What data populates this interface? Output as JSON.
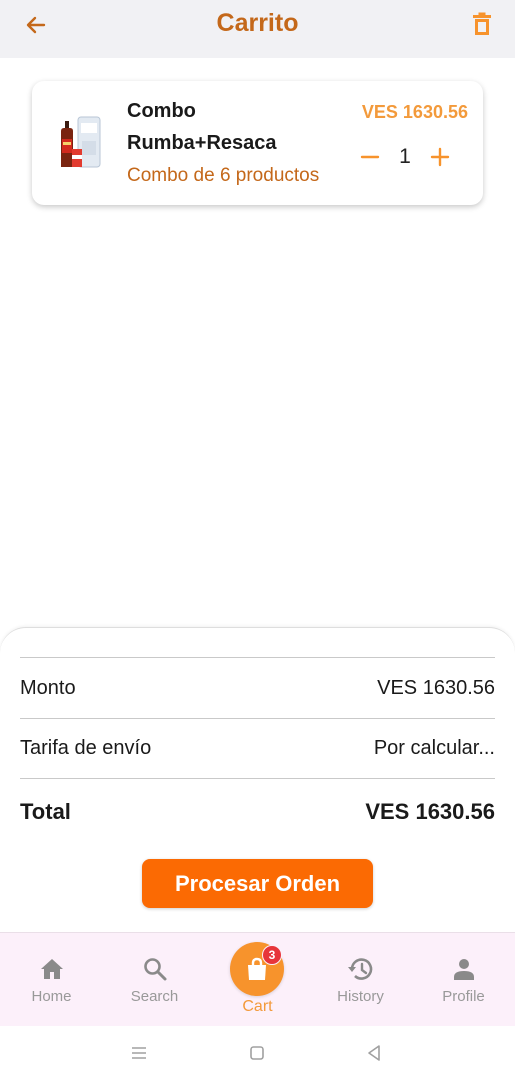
{
  "appbar": {
    "title": "Carrito",
    "back_icon": "arrow-left-icon",
    "delete_icon": "trash-icon"
  },
  "cart_item": {
    "name": "Combo Rumba+Resaca",
    "subtitle": "Combo de 6 productos",
    "price": "VES 1630.56",
    "quantity": "1",
    "decrement_icon": "minus-icon",
    "increment_icon": "plus-icon"
  },
  "summary": {
    "amount_label": "Monto",
    "amount_value": "VES 1630.56",
    "shipping_label": "Tarifa de envío",
    "shipping_value": "Por calcular...",
    "total_label": "Total",
    "total_value": "VES 1630.56",
    "process_button": "Procesar Orden"
  },
  "bottom_nav": {
    "items": [
      {
        "label": "Home",
        "icon": "home-icon"
      },
      {
        "label": "Search",
        "icon": "search-icon"
      },
      {
        "label": "Cart",
        "icon": "shopping-bag-icon",
        "badge": "3",
        "active": true
      },
      {
        "label": "History",
        "icon": "history-icon"
      },
      {
        "label": "Profile",
        "icon": "person-icon"
      }
    ]
  },
  "colors": {
    "title": "#c4681a",
    "accent": "#f39a3b",
    "primary_button": "#fb6a03",
    "badge": "#e7353a",
    "nav_background": "#fcf0fa",
    "appbar_background": "#f1f1f4"
  }
}
